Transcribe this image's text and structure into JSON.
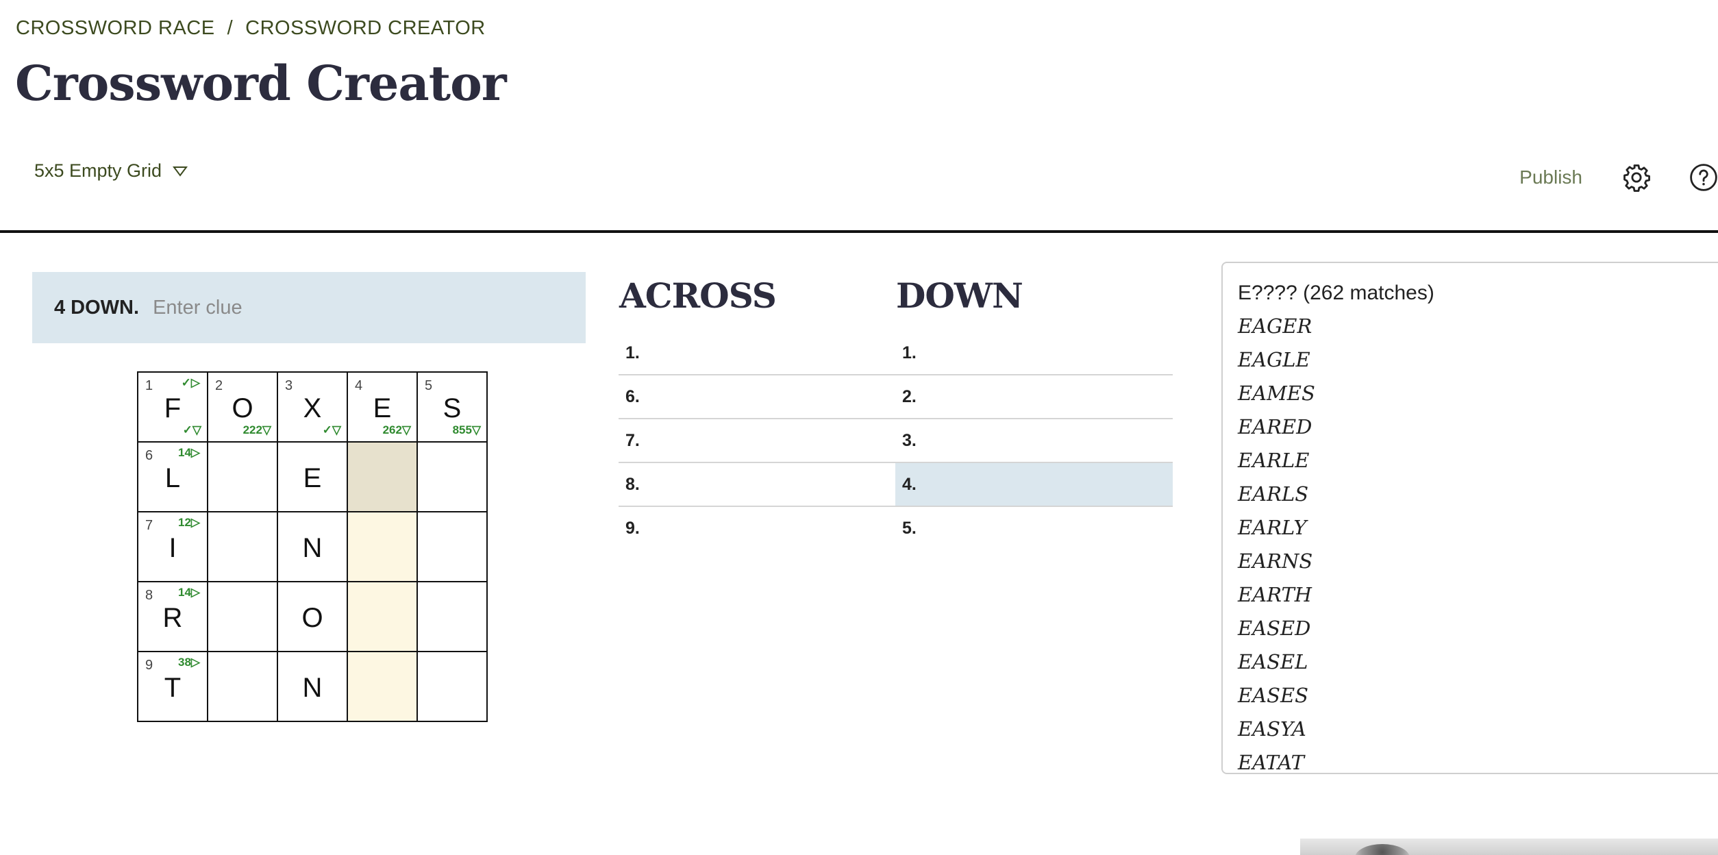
{
  "breadcrumb": {
    "home": "CROSSWORD RACE",
    "separator": "/",
    "current": "CROSSWORD CREATOR"
  },
  "title": "Crossword Creator",
  "grid_select": {
    "selected": "5x5 Empty Grid"
  },
  "toolbar": {
    "publish": "Publish"
  },
  "clue_editor": {
    "label": "4 DOWN.",
    "placeholder": "Enter clue"
  },
  "grid": {
    "cells": [
      {
        "num": "1",
        "letter": "F",
        "top": "✓▷",
        "bot": "✓▽"
      },
      {
        "num": "2",
        "letter": "O",
        "top": "",
        "bot": "222▽"
      },
      {
        "num": "3",
        "letter": "X",
        "top": "",
        "bot": "✓▽"
      },
      {
        "num": "4",
        "letter": "E",
        "top": "",
        "bot": "262▽"
      },
      {
        "num": "5",
        "letter": "S",
        "top": "",
        "bot": "855▽"
      },
      {
        "num": "6",
        "letter": "L",
        "top": "14▷",
        "bot": ""
      },
      {
        "num": "",
        "letter": "",
        "top": "",
        "bot": ""
      },
      {
        "num": "",
        "letter": "E",
        "top": "",
        "bot": ""
      },
      {
        "num": "",
        "letter": "",
        "top": "",
        "bot": ""
      },
      {
        "num": "",
        "letter": "",
        "top": "",
        "bot": ""
      },
      {
        "num": "7",
        "letter": "I",
        "top": "12▷",
        "bot": ""
      },
      {
        "num": "",
        "letter": "",
        "top": "",
        "bot": ""
      },
      {
        "num": "",
        "letter": "N",
        "top": "",
        "bot": ""
      },
      {
        "num": "",
        "letter": "",
        "top": "",
        "bot": ""
      },
      {
        "num": "",
        "letter": "",
        "top": "",
        "bot": ""
      },
      {
        "num": "8",
        "letter": "R",
        "top": "14▷",
        "bot": ""
      },
      {
        "num": "",
        "letter": "",
        "top": "",
        "bot": ""
      },
      {
        "num": "",
        "letter": "O",
        "top": "",
        "bot": ""
      },
      {
        "num": "",
        "letter": "",
        "top": "",
        "bot": ""
      },
      {
        "num": "",
        "letter": "",
        "top": "",
        "bot": ""
      },
      {
        "num": "9",
        "letter": "T",
        "top": "38▷",
        "bot": ""
      },
      {
        "num": "",
        "letter": "",
        "top": "",
        "bot": ""
      },
      {
        "num": "",
        "letter": "N",
        "top": "",
        "bot": ""
      },
      {
        "num": "",
        "letter": "",
        "top": "",
        "bot": ""
      },
      {
        "num": "",
        "letter": "",
        "top": "",
        "bot": ""
      }
    ]
  },
  "across": {
    "heading": "ACROSS",
    "items": [
      "1.",
      "6.",
      "7.",
      "8.",
      "9."
    ]
  },
  "down": {
    "heading": "DOWN",
    "items": [
      "1.",
      "2.",
      "3.",
      "4.",
      "5."
    ]
  },
  "matches": {
    "count_text": "E???? (262 matches)",
    "words": [
      "EAGER",
      "EAGLE",
      "EAMES",
      "EARED",
      "EARLE",
      "EARLS",
      "EARLY",
      "EARNS",
      "EARTH",
      "EASED",
      "EASEL",
      "EASES",
      "EASYA",
      "EATAT"
    ]
  },
  "colors": {
    "highlight_blue": "#dbe7ee",
    "selected_column": "#fdf7e2",
    "active_cell": "#e7e1cd",
    "hint_green": "#2f8a2f"
  },
  "icons": {
    "dropdown": "chevron-down-icon",
    "settings": "gear-icon",
    "help": "help-icon"
  }
}
